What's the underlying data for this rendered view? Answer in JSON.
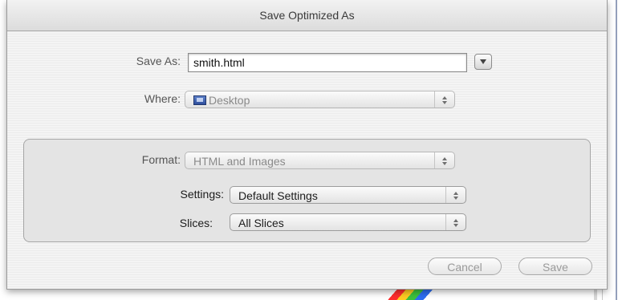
{
  "dialog": {
    "title": "Save Optimized As"
  },
  "save_as": {
    "label": "Save As:",
    "value": "smith.html"
  },
  "where": {
    "label": "Where:",
    "value": "Desktop",
    "icon": "folder-icon"
  },
  "format": {
    "label": "Format:",
    "value": "HTML and Images"
  },
  "settings": {
    "label": "Settings:",
    "value": "Default Settings"
  },
  "slices": {
    "label": "Slices:",
    "value": "All Slices"
  },
  "buttons": {
    "cancel": "Cancel",
    "save": "Save"
  }
}
